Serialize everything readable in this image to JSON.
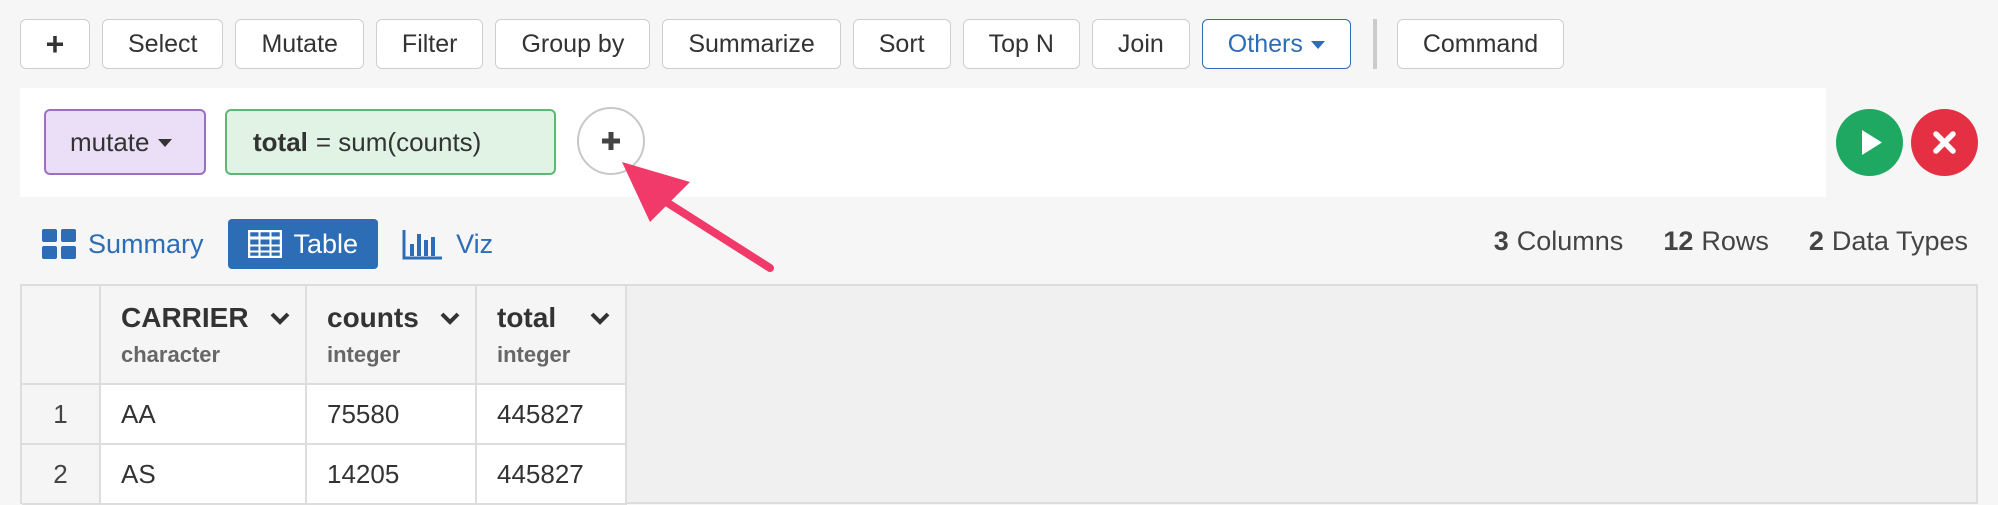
{
  "toolbar": {
    "add_label": "+",
    "buttons": [
      "Select",
      "Mutate",
      "Filter",
      "Group by",
      "Summarize",
      "Sort",
      "Top N",
      "Join"
    ],
    "others_label": "Others",
    "command_label": "Command"
  },
  "editor": {
    "verb": "mutate",
    "expr_column": "total",
    "expr_rest": "= sum(counts)"
  },
  "view_tabs": {
    "summary": "Summary",
    "table": "Table",
    "viz": "Viz"
  },
  "stats": {
    "columns_count": "3",
    "columns_label": "Columns",
    "rows_count": "12",
    "rows_label": "Rows",
    "types_count": "2",
    "types_label": "Data Types"
  },
  "table": {
    "columns": [
      {
        "name": "CARRIER",
        "type": "character"
      },
      {
        "name": "counts",
        "type": "integer"
      },
      {
        "name": "total",
        "type": "integer"
      }
    ],
    "rows": [
      {
        "idx": "1",
        "cells": [
          "AA",
          "75580",
          "445827"
        ]
      },
      {
        "idx": "2",
        "cells": [
          "AS",
          "14205",
          "445827"
        ]
      }
    ]
  },
  "colors": {
    "accent": "#2d6db5",
    "run": "#1fa861",
    "cancel": "#e53044",
    "annotation_arrow": "#f23a6a"
  },
  "icons": [
    "plus-icon",
    "caret-down-icon",
    "play-icon",
    "close-icon",
    "grid-icon",
    "table-icon",
    "bar-chart-icon",
    "chevron-down-icon",
    "annotation-arrow"
  ]
}
